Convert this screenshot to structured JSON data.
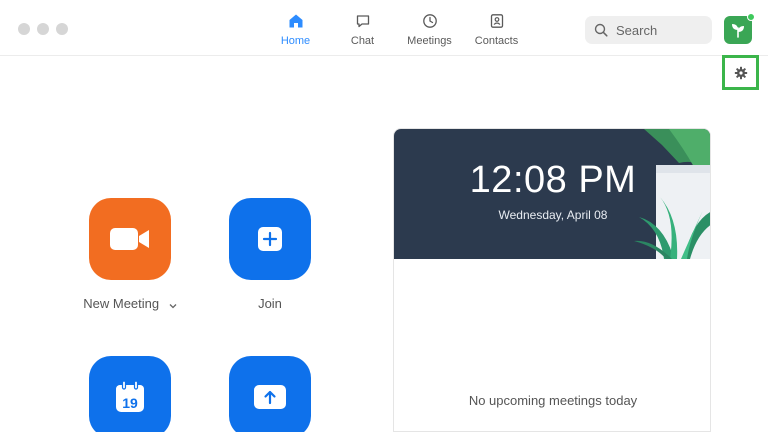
{
  "nav": {
    "items": [
      {
        "label": "Home",
        "icon": "home-icon",
        "active": true
      },
      {
        "label": "Chat",
        "icon": "chat-icon",
        "active": false
      },
      {
        "label": "Meetings",
        "icon": "clock-icon",
        "active": false
      },
      {
        "label": "Contacts",
        "icon": "contacts-icon",
        "active": false
      }
    ]
  },
  "search": {
    "placeholder": "Search"
  },
  "actions": {
    "new_meeting": {
      "label": "New Meeting",
      "icon": "video-camera-icon"
    },
    "join": {
      "label": "Join",
      "icon": "plus-icon"
    },
    "schedule": {
      "icon": "calendar-icon",
      "day": "19"
    },
    "share": {
      "icon": "upload-arrow-icon"
    }
  },
  "panel": {
    "time": "12:08 PM",
    "date": "Wednesday, April 08",
    "empty_message": "No upcoming meetings today"
  },
  "colors": {
    "accent": "#2d8cff",
    "orange": "#f26d21",
    "blue": "#0e71eb",
    "banner": "#2c3a4e",
    "highlight": "#3bb54a"
  }
}
